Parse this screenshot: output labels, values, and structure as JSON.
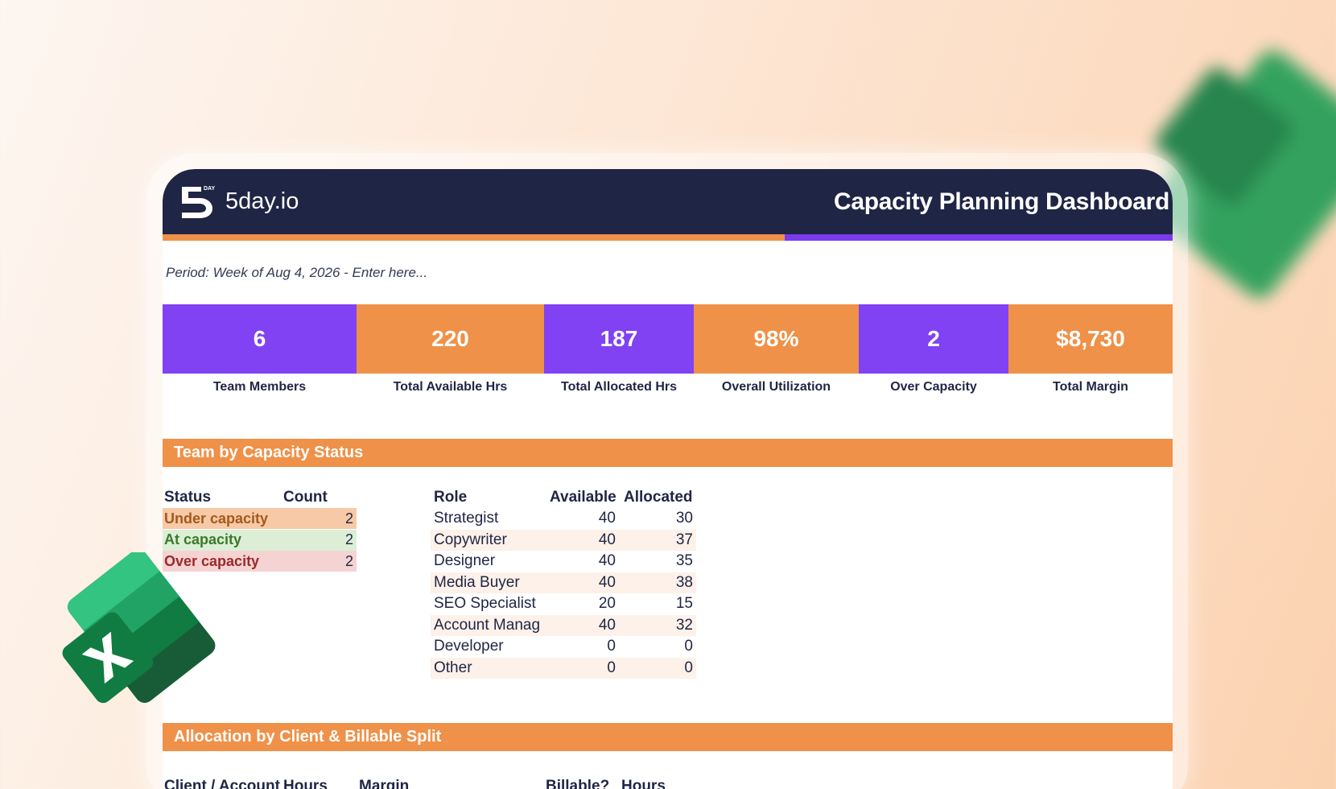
{
  "brand": {
    "name": "5day.io",
    "logo_mark": "5",
    "logo_small": "DAY"
  },
  "header": {
    "title": "Capacity Planning Dashboard"
  },
  "period": {
    "text": "Period: Week of Aug 4, 2026 - Enter here..."
  },
  "kpis": [
    {
      "value": "6",
      "label": "Team Members",
      "color": "#8042f2"
    },
    {
      "value": "220",
      "label": "Total Available Hrs",
      "color": "#ef9148"
    },
    {
      "value": "187",
      "label": "Total Allocated Hrs",
      "color": "#8042f2"
    },
    {
      "value": "98%",
      "label": "Overall Utilization",
      "color": "#ef9148"
    },
    {
      "value": "2",
      "label": "Over Capacity",
      "color": "#8042f2"
    },
    {
      "value": "$8,730",
      "label": "Total Margin",
      "color": "#ef9148"
    }
  ],
  "section1": {
    "title": "Team by Capacity Status"
  },
  "status_table": {
    "headers": [
      "Status",
      "Count"
    ],
    "rows": [
      {
        "status": "Under capacity",
        "count": "2",
        "bg": "#f7c9a6",
        "fg": "#a35a1a"
      },
      {
        "status": "At capacity",
        "count": "2",
        "bg": "#dcefd6",
        "fg": "#3a7a28"
      },
      {
        "status": "Over capacity",
        "count": "2",
        "bg": "#f5d3d3",
        "fg": "#9b2a2a"
      }
    ]
  },
  "role_table": {
    "headers": [
      "Role",
      "Available",
      "Allocated"
    ],
    "rows": [
      [
        "Strategist",
        "40",
        "30"
      ],
      [
        "Copywriter",
        "40",
        "37"
      ],
      [
        "Designer",
        "40",
        "35"
      ],
      [
        "Media Buyer",
        "40",
        "38"
      ],
      [
        "SEO Specialist",
        "20",
        "15"
      ],
      [
        "Account Manag",
        "40",
        "32"
      ],
      [
        "Developer",
        "0",
        "0"
      ],
      [
        "Other",
        "0",
        "0"
      ]
    ]
  },
  "section2": {
    "title": "Allocation by Client & Billable Split"
  },
  "alloc_headers": {
    "client": "Client / Account",
    "hours": "Hours",
    "margin": "Margin",
    "billable": "Billable?",
    "hours2": "Hours"
  },
  "colors": {
    "navy": "#1f2544",
    "orange": "#ef9148",
    "purple": "#8042f2"
  }
}
